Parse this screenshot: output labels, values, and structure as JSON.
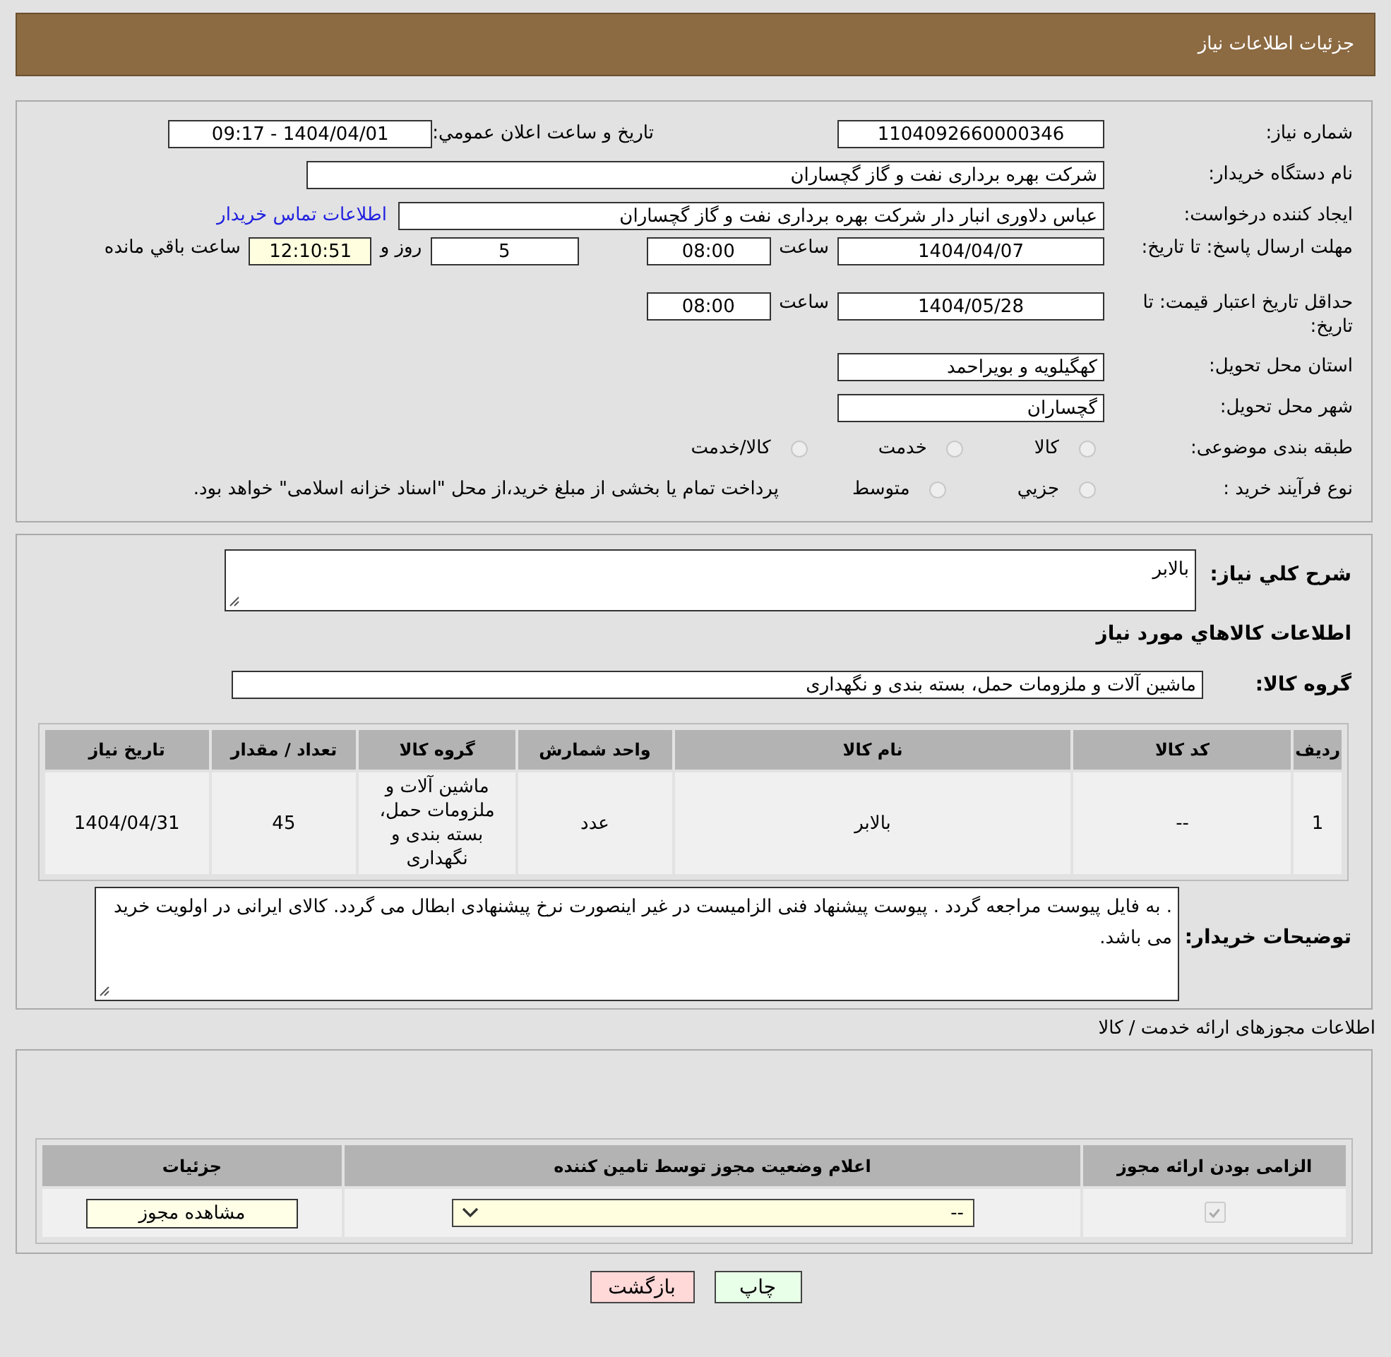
{
  "header": {
    "title": "جزئیات اطلاعات نیاز"
  },
  "details": {
    "need_number": {
      "label": "شماره نیاز:",
      "value": "1104092660000346"
    },
    "announce": {
      "label": "تاریخ و ساعت اعلان عمومي:",
      "value": "1404/04/01 - 09:17"
    },
    "buyer": {
      "label": "نام دستگاه خریدار:",
      "value": "شرکت بهره برداری نفت و گاز گچساران"
    },
    "creator": {
      "label": "ایجاد کننده درخواست:",
      "value": "عباس دلاوری انبار دار شرکت بهره برداری نفت و گاز گچساران",
      "link": "اطلاعات تماس خریدار"
    },
    "deadline": {
      "label": "مهلت ارسال پاسخ: تا تاریخ:",
      "date": "1404/04/07",
      "time_label": "ساعت",
      "time": "08:00",
      "days": "5",
      "days_label": "روز و",
      "remaining": "12:10:51",
      "remaining_label": "ساعت باقي مانده"
    },
    "validity": {
      "label": "حداقل تاریخ اعتبار قیمت: تا تاریخ:",
      "date": "1404/05/28",
      "time_label": "ساعت",
      "time": "08:00"
    },
    "province": {
      "label": "استان محل تحویل:",
      "value": "کهگیلویه و بویراحمد"
    },
    "city": {
      "label": "شهر محل تحویل:",
      "value": "گچساران"
    },
    "category": {
      "label": "طبقه بندی موضوعی:",
      "options": [
        {
          "label": "کالا",
          "selected": false
        },
        {
          "label": "خدمت",
          "selected": false
        },
        {
          "label": "کالا/خدمت",
          "selected": false
        }
      ]
    },
    "process": {
      "label": "نوع فرآیند خرید :",
      "options": [
        {
          "label": "جزيي",
          "selected": false
        },
        {
          "label": "متوسط",
          "selected": false
        }
      ],
      "note": "پرداخت تمام یا بخشی از مبلغ خرید،از محل \"اسناد خزانه اسلامی\" خواهد بود."
    }
  },
  "goods": {
    "description_label": "شرح کلي نياز:",
    "description": "بالابر",
    "section_title": "اطلاعات کالاهاي مورد نياز",
    "group_label": "گروه کالا:",
    "group": "ماشین آلات و ملزومات حمل، بسته بندی و نگهداری",
    "table": {
      "columns": [
        "ردیف",
        "کد کالا",
        "نام کالا",
        "واحد شمارش",
        "گروه کالا",
        "تعداد / مقدار",
        "تاریخ نیاز"
      ],
      "rows": [
        [
          "1",
          "--",
          "بالابر",
          "عدد",
          "ماشین آلات و ملزومات حمل، بسته بندی و نگهداری",
          "45",
          "1404/04/31"
        ]
      ]
    },
    "notes_label": "توضیحات خریدار:",
    "notes": ". به فایل پیوست مراجعه گردد . پیوست پیشنهاد فنی الزامیست در غیر اینصورت نرخ پیشنهادی ابطال می گردد. کالای ایرانی در اولویت خرید می باشد."
  },
  "permits": {
    "title": "اطلاعات مجوزهای ارائه خدمت / کالا",
    "columns": [
      "الزامی بودن ارائه مجوز",
      "اعلام وضعیت مجوز توسط تامین کننده",
      "جزئیات"
    ],
    "rows": [
      {
        "required": true,
        "status": "--",
        "action": "مشاهده مجوز"
      }
    ]
  },
  "buttons": [
    {
      "kind": "print",
      "label": "چاپ"
    },
    {
      "kind": "back",
      "label": "بازگشت"
    }
  ]
}
